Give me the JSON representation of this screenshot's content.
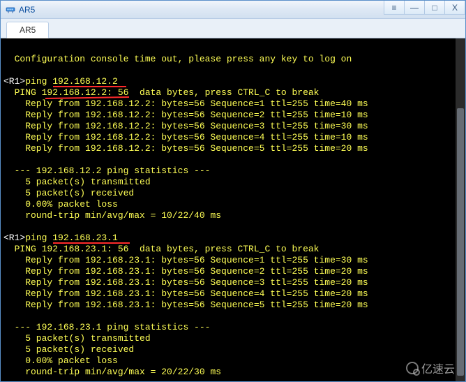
{
  "window": {
    "title": "AR5",
    "icon": "network-device-icon"
  },
  "controls": {
    "menu_glyph": "≡",
    "min_glyph": "—",
    "max_glyph": "□",
    "close_glyph": "X"
  },
  "tabs": [
    {
      "label": "AR5",
      "active": true
    }
  ],
  "terminal": {
    "intro_line": "  Configuration console time out, please press any key to log on",
    "session1": {
      "prompt_host": "<R1>",
      "prompt_cmd": "ping 192.168.12.2",
      "header": "  PING 192.168.12.2: 56  data bytes, press CTRL_C to break",
      "replies": [
        "    Reply from 192.168.12.2: bytes=56 Sequence=1 ttl=255 time=40 ms",
        "    Reply from 192.168.12.2: bytes=56 Sequence=2 ttl=255 time=10 ms",
        "    Reply from 192.168.12.2: bytes=56 Sequence=3 ttl=255 time=30 ms",
        "    Reply from 192.168.12.2: bytes=56 Sequence=4 ttl=255 time=10 ms",
        "    Reply from 192.168.12.2: bytes=56 Sequence=5 ttl=255 time=20 ms"
      ],
      "stats_header": "  --- 192.168.12.2 ping statistics ---",
      "stats_lines": [
        "    5 packet(s) transmitted",
        "    5 packet(s) received",
        "    0.00% packet loss",
        "    round-trip min/avg/max = 10/22/40 ms"
      ]
    },
    "session2": {
      "prompt_host": "<R1>",
      "prompt_cmd": "ping 192.168.23.1",
      "header": "  PING 192.168.23.1: 56  data bytes, press CTRL_C to break",
      "replies": [
        "    Reply from 192.168.23.1: bytes=56 Sequence=1 ttl=255 time=30 ms",
        "    Reply from 192.168.23.1: bytes=56 Sequence=2 ttl=255 time=20 ms",
        "    Reply from 192.168.23.1: bytes=56 Sequence=3 ttl=255 time=20 ms",
        "    Reply from 192.168.23.1: bytes=56 Sequence=4 ttl=255 time=20 ms",
        "    Reply from 192.168.23.1: bytes=56 Sequence=5 ttl=255 time=20 ms"
      ],
      "stats_header": "  --- 192.168.23.1 ping statistics ---",
      "stats_lines": [
        "    5 packet(s) transmitted",
        "    5 packet(s) received",
        "    0.00% packet loss",
        "    round-trip min/avg/max = 20/22/30 ms"
      ]
    }
  },
  "watermark": {
    "text": "亿速云"
  }
}
